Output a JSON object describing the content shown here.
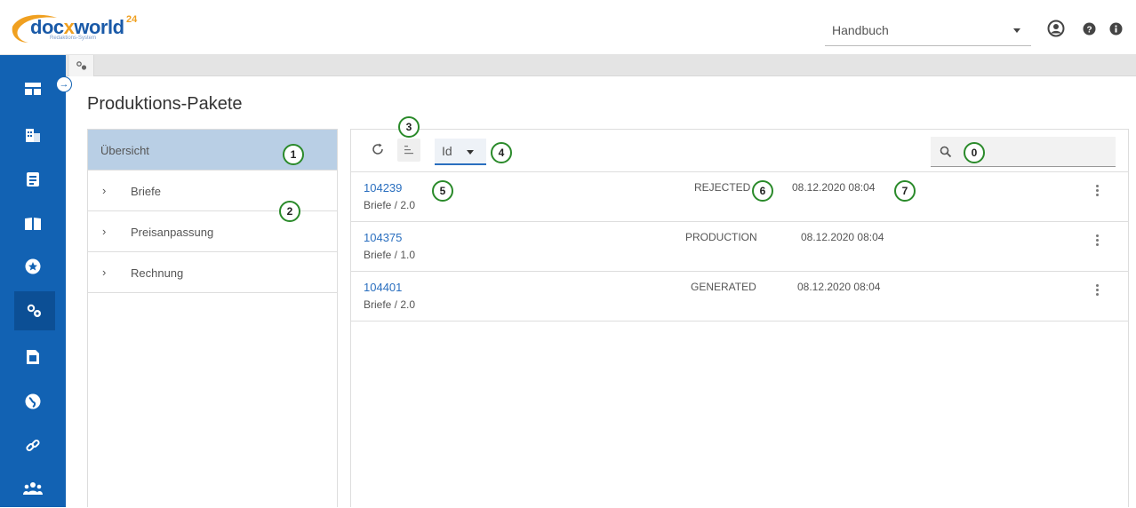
{
  "app": {
    "logo_text_a": "doc",
    "logo_text_x": "x",
    "logo_text_b": "world",
    "logo_sup": "24",
    "logo_sub": "Redaktions-System"
  },
  "topbar": {
    "handbook_select": "Handbuch"
  },
  "sidebar": {
    "items": [
      {
        "icon": "dashboard-icon"
      },
      {
        "icon": "buildings-icon"
      },
      {
        "icon": "document-icon"
      },
      {
        "icon": "book-icon"
      },
      {
        "icon": "star-icon"
      },
      {
        "icon": "gears-icon",
        "active": true
      },
      {
        "icon": "file-icon"
      },
      {
        "icon": "globe-icon"
      },
      {
        "icon": "link-icon"
      },
      {
        "icon": "users-icon"
      }
    ]
  },
  "page": {
    "title": "Produktions-Pakete"
  },
  "left_panel": {
    "header": "Übersicht",
    "items": [
      {
        "label": "Briefe"
      },
      {
        "label": "Preisanpassung"
      },
      {
        "label": "Rechnung"
      }
    ]
  },
  "toolbar": {
    "sort_value": "Id"
  },
  "packages": [
    {
      "id": "104239",
      "sub": "Briefe / 2.0",
      "status": "REJECTED",
      "date": "08.12.2020 08:04"
    },
    {
      "id": "104375",
      "sub": "Briefe / 1.0",
      "status": "PRODUCTION",
      "date": "08.12.2020 08:04"
    },
    {
      "id": "104401",
      "sub": "Briefe / 2.0",
      "status": "GENERATED",
      "date": "08.12.2020 08:04"
    }
  ],
  "callouts": [
    "0",
    "1",
    "2",
    "3",
    "4",
    "5",
    "6",
    "7"
  ],
  "colors": {
    "sidebar": "#1262b3",
    "selected_row": "#b9cfe5",
    "link": "#2a6fbf",
    "callout_ring": "#2a8a2a"
  }
}
